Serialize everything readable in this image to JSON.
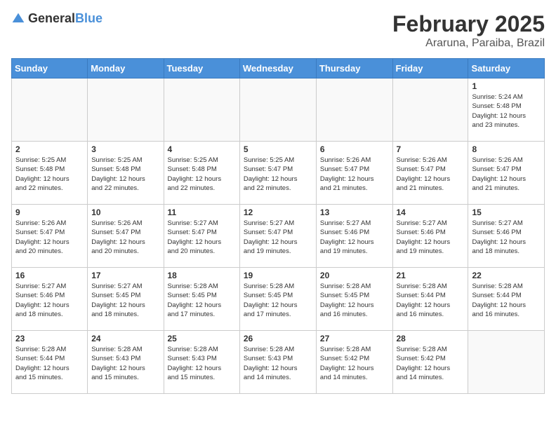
{
  "logo": {
    "general": "General",
    "blue": "Blue"
  },
  "header": {
    "month": "February 2025",
    "location": "Araruna, Paraiba, Brazil"
  },
  "weekdays": [
    "Sunday",
    "Monday",
    "Tuesday",
    "Wednesday",
    "Thursday",
    "Friday",
    "Saturday"
  ],
  "weeks": [
    [
      {
        "day": "",
        "info": ""
      },
      {
        "day": "",
        "info": ""
      },
      {
        "day": "",
        "info": ""
      },
      {
        "day": "",
        "info": ""
      },
      {
        "day": "",
        "info": ""
      },
      {
        "day": "",
        "info": ""
      },
      {
        "day": "1",
        "info": "Sunrise: 5:24 AM\nSunset: 5:48 PM\nDaylight: 12 hours\nand 23 minutes."
      }
    ],
    [
      {
        "day": "2",
        "info": "Sunrise: 5:25 AM\nSunset: 5:48 PM\nDaylight: 12 hours\nand 22 minutes."
      },
      {
        "day": "3",
        "info": "Sunrise: 5:25 AM\nSunset: 5:48 PM\nDaylight: 12 hours\nand 22 minutes."
      },
      {
        "day": "4",
        "info": "Sunrise: 5:25 AM\nSunset: 5:48 PM\nDaylight: 12 hours\nand 22 minutes."
      },
      {
        "day": "5",
        "info": "Sunrise: 5:25 AM\nSunset: 5:47 PM\nDaylight: 12 hours\nand 22 minutes."
      },
      {
        "day": "6",
        "info": "Sunrise: 5:26 AM\nSunset: 5:47 PM\nDaylight: 12 hours\nand 21 minutes."
      },
      {
        "day": "7",
        "info": "Sunrise: 5:26 AM\nSunset: 5:47 PM\nDaylight: 12 hours\nand 21 minutes."
      },
      {
        "day": "8",
        "info": "Sunrise: 5:26 AM\nSunset: 5:47 PM\nDaylight: 12 hours\nand 21 minutes."
      }
    ],
    [
      {
        "day": "9",
        "info": "Sunrise: 5:26 AM\nSunset: 5:47 PM\nDaylight: 12 hours\nand 20 minutes."
      },
      {
        "day": "10",
        "info": "Sunrise: 5:26 AM\nSunset: 5:47 PM\nDaylight: 12 hours\nand 20 minutes."
      },
      {
        "day": "11",
        "info": "Sunrise: 5:27 AM\nSunset: 5:47 PM\nDaylight: 12 hours\nand 20 minutes."
      },
      {
        "day": "12",
        "info": "Sunrise: 5:27 AM\nSunset: 5:47 PM\nDaylight: 12 hours\nand 19 minutes."
      },
      {
        "day": "13",
        "info": "Sunrise: 5:27 AM\nSunset: 5:46 PM\nDaylight: 12 hours\nand 19 minutes."
      },
      {
        "day": "14",
        "info": "Sunrise: 5:27 AM\nSunset: 5:46 PM\nDaylight: 12 hours\nand 19 minutes."
      },
      {
        "day": "15",
        "info": "Sunrise: 5:27 AM\nSunset: 5:46 PM\nDaylight: 12 hours\nand 18 minutes."
      }
    ],
    [
      {
        "day": "16",
        "info": "Sunrise: 5:27 AM\nSunset: 5:46 PM\nDaylight: 12 hours\nand 18 minutes."
      },
      {
        "day": "17",
        "info": "Sunrise: 5:27 AM\nSunset: 5:45 PM\nDaylight: 12 hours\nand 18 minutes."
      },
      {
        "day": "18",
        "info": "Sunrise: 5:28 AM\nSunset: 5:45 PM\nDaylight: 12 hours\nand 17 minutes."
      },
      {
        "day": "19",
        "info": "Sunrise: 5:28 AM\nSunset: 5:45 PM\nDaylight: 12 hours\nand 17 minutes."
      },
      {
        "day": "20",
        "info": "Sunrise: 5:28 AM\nSunset: 5:45 PM\nDaylight: 12 hours\nand 16 minutes."
      },
      {
        "day": "21",
        "info": "Sunrise: 5:28 AM\nSunset: 5:44 PM\nDaylight: 12 hours\nand 16 minutes."
      },
      {
        "day": "22",
        "info": "Sunrise: 5:28 AM\nSunset: 5:44 PM\nDaylight: 12 hours\nand 16 minutes."
      }
    ],
    [
      {
        "day": "23",
        "info": "Sunrise: 5:28 AM\nSunset: 5:44 PM\nDaylight: 12 hours\nand 15 minutes."
      },
      {
        "day": "24",
        "info": "Sunrise: 5:28 AM\nSunset: 5:43 PM\nDaylight: 12 hours\nand 15 minutes."
      },
      {
        "day": "25",
        "info": "Sunrise: 5:28 AM\nSunset: 5:43 PM\nDaylight: 12 hours\nand 15 minutes."
      },
      {
        "day": "26",
        "info": "Sunrise: 5:28 AM\nSunset: 5:43 PM\nDaylight: 12 hours\nand 14 minutes."
      },
      {
        "day": "27",
        "info": "Sunrise: 5:28 AM\nSunset: 5:42 PM\nDaylight: 12 hours\nand 14 minutes."
      },
      {
        "day": "28",
        "info": "Sunrise: 5:28 AM\nSunset: 5:42 PM\nDaylight: 12 hours\nand 14 minutes."
      },
      {
        "day": "",
        "info": ""
      }
    ]
  ]
}
